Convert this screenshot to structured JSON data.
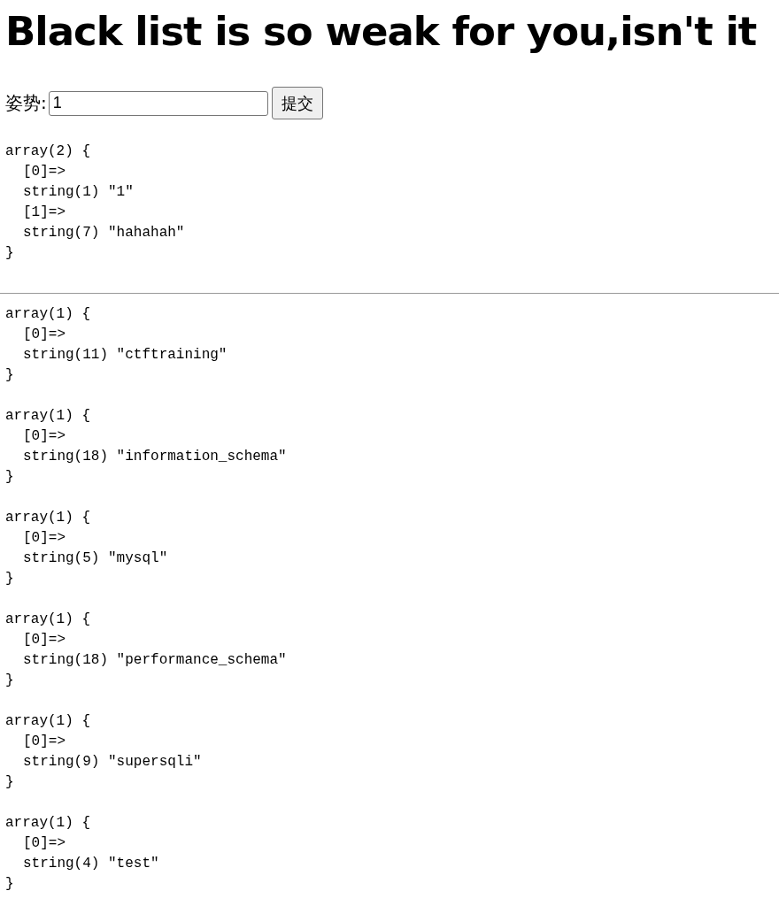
{
  "title": "Black list is so weak for you,isn't it",
  "form": {
    "label": "姿势:",
    "value": "1",
    "button": "提交"
  },
  "query_dump": {
    "header": "array(2) {",
    "entries": [
      {
        "key": "[0]=>",
        "value": "string(1) \"1\""
      },
      {
        "key": "[1]=>",
        "value": "string(7) \"hahahah\""
      }
    ],
    "close": "}"
  },
  "result_dumps": [
    {
      "header": "array(1) {",
      "entries": [
        {
          "key": "[0]=>",
          "value": "string(11) \"ctftraining\""
        }
      ],
      "close": "}"
    },
    {
      "header": "array(1) {",
      "entries": [
        {
          "key": "[0]=>",
          "value": "string(18) \"information_schema\""
        }
      ],
      "close": "}"
    },
    {
      "header": "array(1) {",
      "entries": [
        {
          "key": "[0]=>",
          "value": "string(5) \"mysql\""
        }
      ],
      "close": "}"
    },
    {
      "header": "array(1) {",
      "entries": [
        {
          "key": "[0]=>",
          "value": "string(18) \"performance_schema\""
        }
      ],
      "close": "}"
    },
    {
      "header": "array(1) {",
      "entries": [
        {
          "key": "[0]=>",
          "value": "string(9) \"supersqli\""
        }
      ],
      "close": "}"
    },
    {
      "header": "array(1) {",
      "entries": [
        {
          "key": "[0]=>",
          "value": "string(4) \"test\""
        }
      ],
      "close": "}"
    }
  ]
}
